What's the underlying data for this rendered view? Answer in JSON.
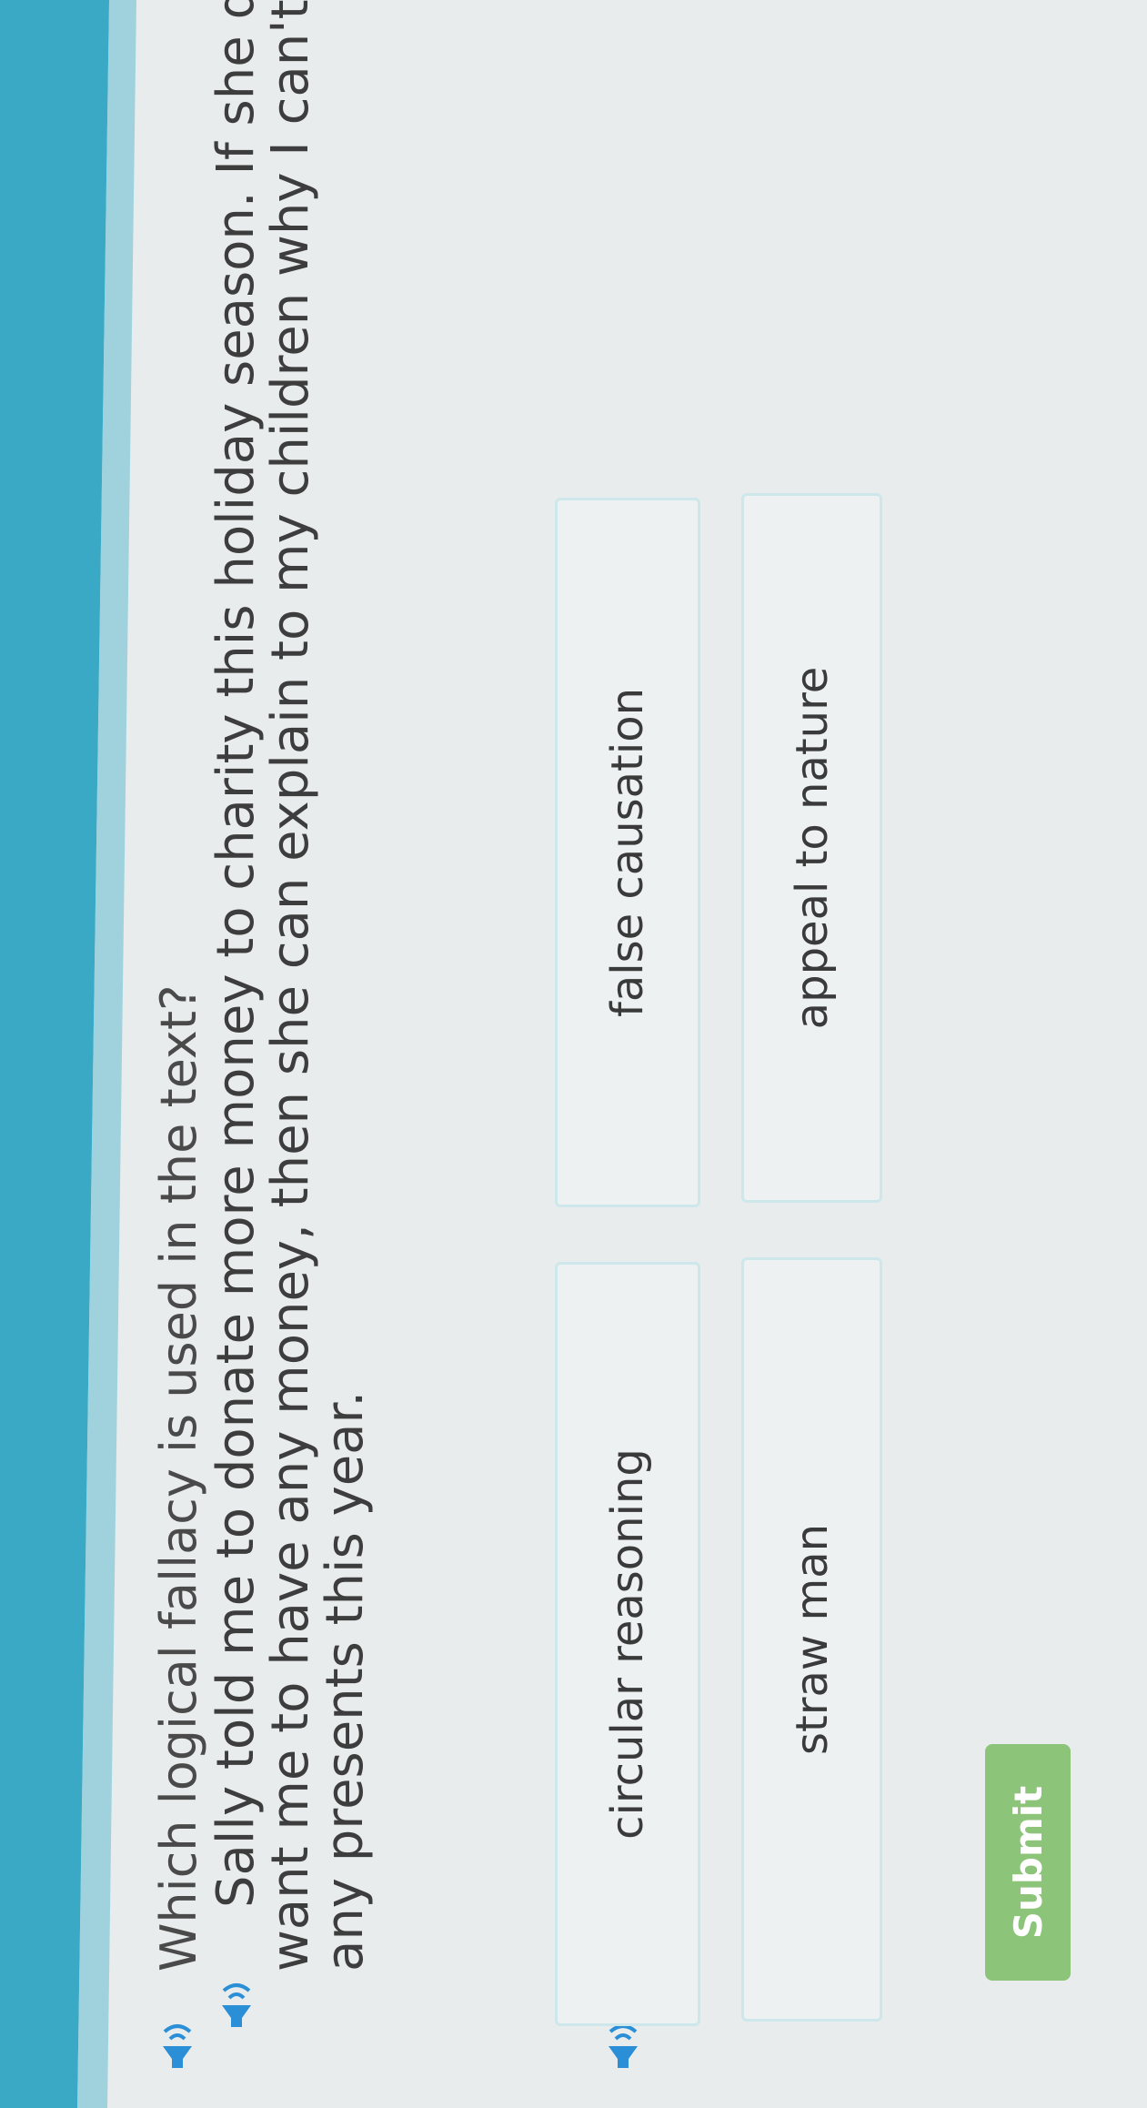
{
  "question": "Which logical fallacy is used in the text?",
  "passage": [
    "Sally told me to donate more money to charity this holiday season. If she doesn't",
    "want me to have any money, then she can explain to my children why I can't buy them",
    "any presents this year."
  ],
  "choices": [
    {
      "label": "circular reasoning"
    },
    {
      "label": "false causation"
    },
    {
      "label": "straw man"
    },
    {
      "label": "appeal to nature"
    }
  ],
  "submit_label": "Submit",
  "colors": {
    "accent_teal": "#3aa9c5",
    "speaker_blue": "#2a8fd6",
    "submit_green": "#8cc47a",
    "choice_border": "#cde7ea"
  },
  "icons": {
    "speaker": "speaker-icon"
  }
}
